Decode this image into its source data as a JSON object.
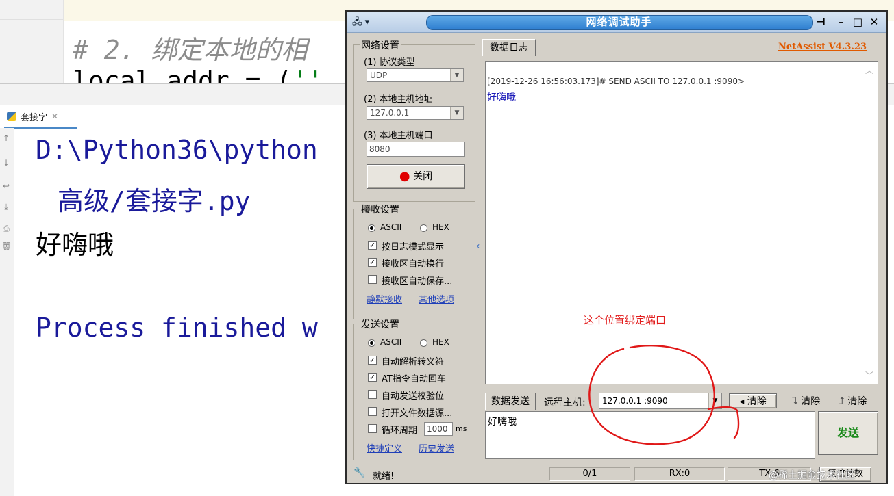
{
  "editor": {
    "comment": "# 2. 绑定本地的相",
    "code_prefix": "local_addr = (",
    "code_string": "''"
  },
  "run_panel": {
    "tab_label": "套接字",
    "console": [
      "D:\\Python36\\python",
      "高级/套接字.py",
      "好嗨哦",
      "Process finished w"
    ]
  },
  "netassist": {
    "title": "网络调试助手",
    "brand": "NetAssist V4.3.23",
    "network_settings": {
      "title": "网络设置",
      "protocol_label": "(1) 协议类型",
      "protocol_value": "UDP",
      "host_label": "(2) 本地主机地址",
      "host_value": "127.0.0.1",
      "port_label": "(3) 本地主机端口",
      "port_value": "8080",
      "close_button": "关闭"
    },
    "receive_settings": {
      "title": "接收设置",
      "ascii": "ASCII",
      "hex": "HEX",
      "opt1": "按日志模式显示",
      "opt2": "接收区自动换行",
      "opt3": "接收区自动保存...",
      "link1": "静默接收",
      "link2": "其他选项"
    },
    "send_settings": {
      "title": "发送设置",
      "ascii": "ASCII",
      "hex": "HEX",
      "opt1": "自动解析转义符",
      "opt2": "AT指令自动回车",
      "opt3": "自动发送校验位",
      "opt4": "打开文件数据源...",
      "opt5": "循环周期",
      "period": "1000",
      "period_unit": "ms",
      "link1": "快捷定义",
      "link2": "历史发送"
    },
    "log": {
      "tab": "数据日志",
      "line1": "[2019-12-26 16:56:03.173]# SEND ASCII TO 127.0.0.1 :9090>",
      "line2": "好嗨哦"
    },
    "annotation": "这个位置绑定端口",
    "send": {
      "tab": "数据发送",
      "remote_label": "远程主机:",
      "remote_value": "127.0.0.1 :9090",
      "clear": "清除",
      "text": "好嗨哦",
      "send_button": "发送"
    },
    "status": {
      "ready": "就绪!",
      "count": "0/1",
      "rx": "RX:0",
      "tx": "TX:6",
      "reset": "复位计数"
    }
  },
  "watermark": "@稀土掘金技术社区",
  "colors": {
    "title_bar": "#2f7fd0",
    "brand": "#e05a00",
    "annotation": "#e21d1d",
    "send_button_text": "#1a8a1a"
  }
}
